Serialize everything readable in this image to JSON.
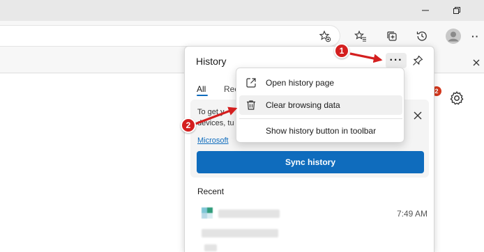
{
  "panel": {
    "title": "History",
    "tabs": [
      {
        "label": "All"
      },
      {
        "label": "Rec"
      }
    ],
    "sync_card": {
      "text_line1": "To get y",
      "text_line2": "devices, tu",
      "link": "Microsoft",
      "button": "Sync history"
    },
    "recent_header": "Recent",
    "entries": [
      {
        "time": "7:49 AM"
      }
    ]
  },
  "menu": {
    "items": [
      {
        "label": "Open history page",
        "icon": "open-external-icon"
      },
      {
        "label": "Clear browsing data",
        "icon": "trash-icon"
      },
      {
        "label": "Show history button in toolbar",
        "icon": ""
      }
    ]
  },
  "settings_badge": "2",
  "annotations": {
    "step1": "1",
    "step2": "2"
  },
  "colors": {
    "accent": "#0f6cbd",
    "annotation": "#d41f1f"
  }
}
